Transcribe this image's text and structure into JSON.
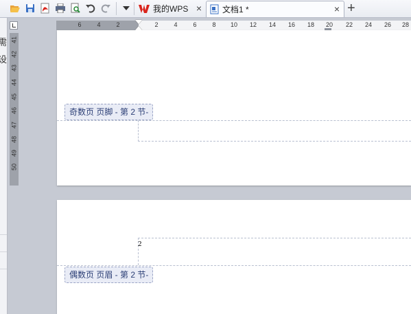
{
  "toolbar": {
    "icons": [
      "open-folder-icon",
      "save-icon",
      "export-pdf-icon",
      "print-icon",
      "print-preview-icon",
      "undo-icon",
      "redo-icon",
      "customize-dropdown-icon"
    ]
  },
  "tabs": [
    {
      "label": "我的WPS",
      "icon": "wps-logo-icon",
      "active": false
    },
    {
      "label": "文档1 *",
      "icon": "document-icon",
      "active": true
    }
  ],
  "new_tab_label": "+",
  "close_glyph": "×",
  "left_strip": {
    "glyph1": "需",
    "glyph2": "设"
  },
  "hruler": {
    "numbers": [
      "6",
      "4",
      "2",
      "2",
      "4",
      "6",
      "8",
      "10",
      "12",
      "14",
      "16",
      "18",
      "20",
      "22",
      "24",
      "26",
      "28"
    ]
  },
  "vruler": {
    "numbers": [
      "41",
      "42",
      "43",
      "44",
      "45",
      "46",
      "47",
      "48",
      "49",
      "50"
    ]
  },
  "page1": {
    "footer_label": "奇数页 页脚 - 第 2 节-"
  },
  "page2": {
    "header_label": "偶数页 页眉 - 第 2 节-",
    "body_text": "2"
  },
  "colors": {
    "accent": "#2b3e75",
    "ruler_dark": "#9ea2aa",
    "background": "#c6cad3",
    "wps_red": "#d9241c"
  }
}
